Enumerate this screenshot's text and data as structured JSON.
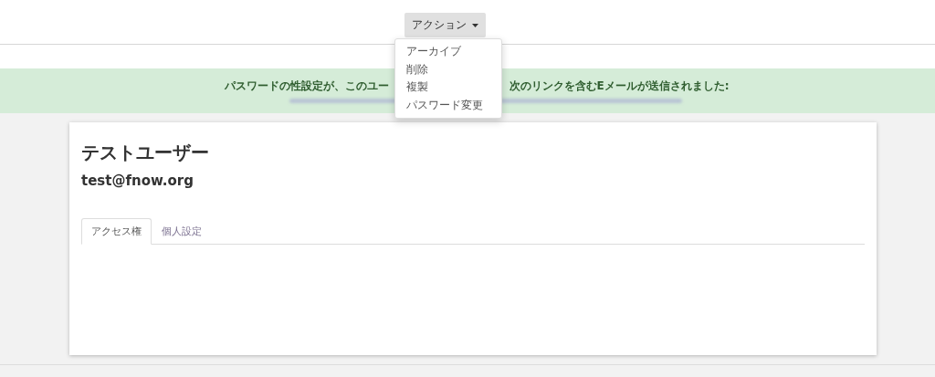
{
  "action_button": {
    "label": "アクション",
    "expanded": true
  },
  "action_menu": {
    "items": [
      {
        "label": "アーカイブ"
      },
      {
        "label": "削除"
      },
      {
        "label": "複製"
      },
      {
        "label": "パスワード変更"
      }
    ]
  },
  "alert": {
    "text_left": "パスワードの性設定が、このユー",
    "text_right": "次のリンクを含むEメールが送信されました:"
  },
  "user": {
    "name": "テストユーザー",
    "email": "test@fnow.org"
  },
  "tabs": [
    {
      "label": "アクセス権",
      "selected": true
    },
    {
      "label": "個人設定",
      "selected": false
    }
  ]
}
